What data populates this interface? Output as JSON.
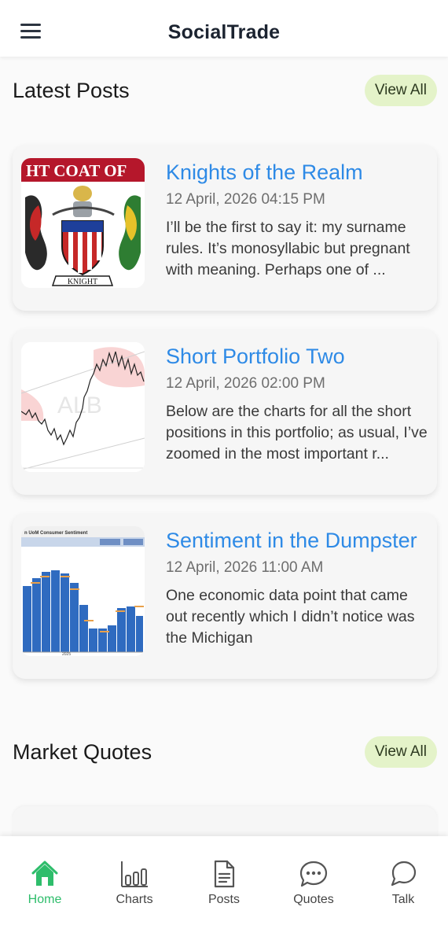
{
  "header": {
    "title": "SocialTrade"
  },
  "latest_posts": {
    "title": "Latest Posts",
    "view_all_label": "View All",
    "posts": [
      {
        "title": "Knights of the Realm",
        "date": "12 April, 2026 04:15 PM",
        "excerpt": "I’ll be the first to say it: my surname rules. It’s monosyllabic but pregnant with meaning. Perhaps one of ...",
        "thumb_banner": "HT COAT OF",
        "thumb_ribbon": "KNIGHT"
      },
      {
        "title": "Short Portfolio Two",
        "date": "12 April, 2026 02:00 PM",
        "excerpt": "Below are the charts for all the short positions in this portfolio; as usual, I’ve zoomed in the most important r...",
        "thumb_watermark": "ALB"
      },
      {
        "title": "Sentiment in the Dumpster",
        "date": "12 April, 2026 11:00 AM",
        "excerpt": "One economic data point that came out recently which I didn’t notice was the Michigan",
        "thumb_header": "n UoM Consumer Sentiment",
        "thumb_year": "2025"
      }
    ]
  },
  "market_quotes": {
    "title": "Market Quotes",
    "view_all_label": "View All"
  },
  "bottom_nav": {
    "active": "Home",
    "items": [
      {
        "label": "Home",
        "icon": "home-icon"
      },
      {
        "label": "Charts",
        "icon": "bar-chart-icon"
      },
      {
        "label": "Posts",
        "icon": "document-icon"
      },
      {
        "label": "Quotes",
        "icon": "chat-dots-icon"
      },
      {
        "label": "Talk",
        "icon": "chat-bubble-icon"
      }
    ]
  },
  "colors": {
    "accent_green": "#2ebd6b",
    "link_blue": "#2e8ae6",
    "view_all_bg": "#e4f3c9"
  }
}
